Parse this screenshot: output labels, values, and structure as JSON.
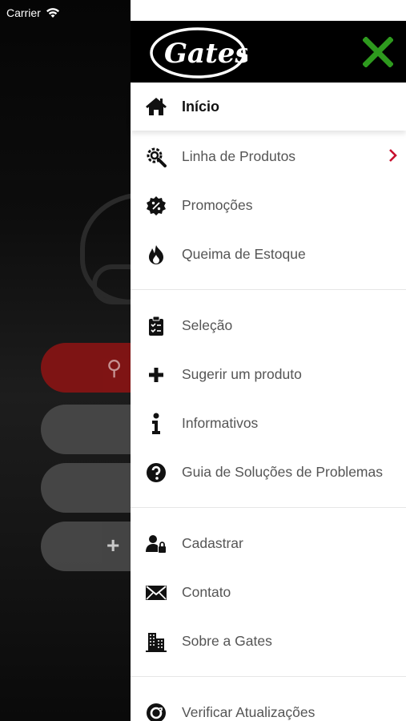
{
  "status_bar": {
    "carrier": "Carrier"
  },
  "header": {
    "logo_text": "Gates"
  },
  "menu": {
    "home": {
      "label": "Início",
      "icon": "home-icon"
    },
    "group1": [
      {
        "label": "Linha de Produtos",
        "icon": "gear-search-icon",
        "has_chevron": true
      },
      {
        "label": "Promoções",
        "icon": "discount-badge-icon"
      },
      {
        "label": "Queima de Estoque",
        "icon": "fire-icon"
      }
    ],
    "group2": [
      {
        "label": "Seleção",
        "icon": "clipboard-check-icon"
      },
      {
        "label": "Sugerir um produto",
        "icon": "plus-icon"
      },
      {
        "label": "Informativos",
        "icon": "info-icon"
      },
      {
        "label": "Guia de Soluções de Problemas",
        "icon": "question-circle-icon"
      }
    ],
    "group3": [
      {
        "label": "Cadastrar",
        "icon": "user-lock-icon"
      },
      {
        "label": "Contato",
        "icon": "envelope-icon"
      },
      {
        "label": "Sobre a Gates",
        "icon": "building-icon"
      }
    ],
    "group4": [
      {
        "label": "Verificar Atualizações",
        "icon": "refresh-circle-icon"
      }
    ]
  },
  "colors": {
    "accent_red": "#c8102e",
    "close_green": "#2e9a1e",
    "header_bg": "#000000"
  }
}
